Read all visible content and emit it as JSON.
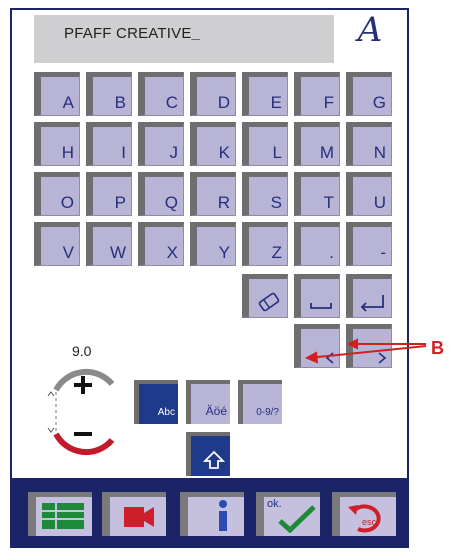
{
  "display": {
    "text": "PFAFF CREATIVE",
    "cursor": "_",
    "font_indicator": "A"
  },
  "keyboard": {
    "rows": [
      [
        "A",
        "B",
        "C",
        "D",
        "E",
        "F",
        "G"
      ],
      [
        "H",
        "I",
        "J",
        "K",
        "L",
        "M",
        "N"
      ],
      [
        "O",
        "P",
        "Q",
        "R",
        "S",
        "T",
        "U"
      ],
      [
        "V",
        "W",
        "X",
        "Y",
        "Z",
        ".",
        "-"
      ]
    ],
    "special_icons": [
      "eraser-icon",
      "space-icon",
      "enter-icon",
      "cursor-left-icon",
      "cursor-right-icon"
    ]
  },
  "size": {
    "value": "9.0",
    "icons": [
      "plus-icon",
      "minus-icon"
    ]
  },
  "modes": [
    {
      "label": "Abc",
      "selected": true
    },
    {
      "label": "Äöé",
      "selected": false
    },
    {
      "label": "0-9/?",
      "selected": false
    }
  ],
  "shift": {
    "icon": "shift-arrow-icon",
    "selected": true
  },
  "toolbar": {
    "icons": [
      "menu-list-icon",
      "video-camera-icon",
      "info-icon",
      "ok-check-icon",
      "esc-back-icon"
    ],
    "ok_label": "ok.",
    "esc_label": "esc"
  },
  "annotation": {
    "label": "B"
  },
  "colors": {
    "frame": "#1a2466",
    "key_fill": "#b8b4d6",
    "key_text": "#262f7c",
    "selected_fill": "#1f3a8a",
    "annotation": "#d12020"
  }
}
